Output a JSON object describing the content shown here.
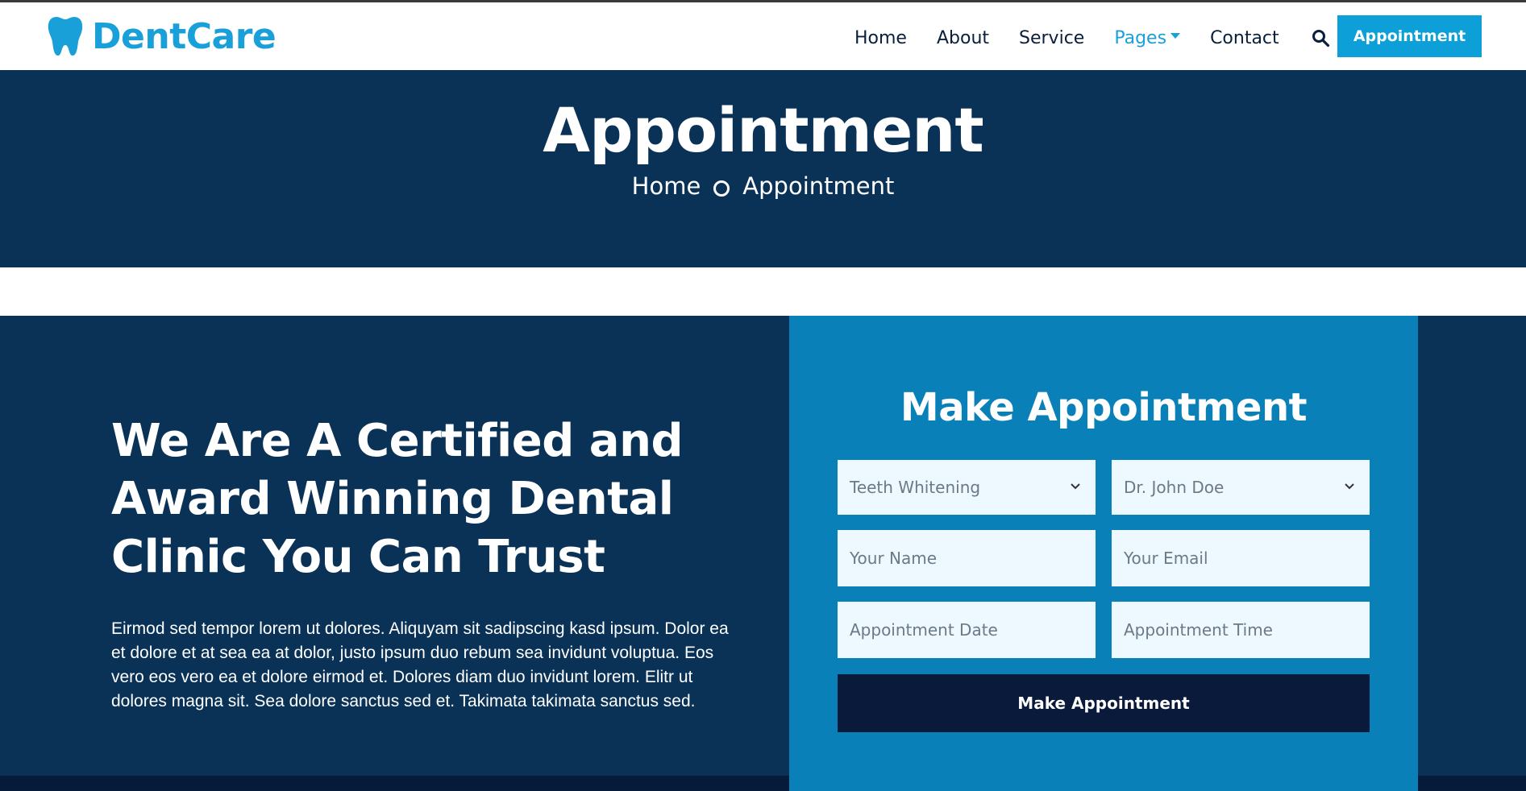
{
  "nav": {
    "brand": "DentCare",
    "links": [
      "Home",
      "About",
      "Service",
      "Pages",
      "Contact"
    ],
    "active_link": "Pages",
    "appointment_button": "Appointment"
  },
  "hero": {
    "title": "Appointment",
    "breadcrumb": [
      "Home",
      "Appointment"
    ]
  },
  "about": {
    "heading": "We Are A Certified and Award Winning Dental Clinic You Can Trust",
    "text": "Eirmod sed tempor lorem ut dolores. Aliquyam sit sadipscing kasd ipsum. Dolor ea et dolore et at sea ea at dolor, justo ipsum duo rebum sea invidunt voluptua. Eos vero eos vero ea et dolore eirmod et. Dolores diam duo invidunt lorem. Elitr ut dolores magna sit. Sea dolore sanctus sed et. Takimata takimata sanctus sed."
  },
  "form": {
    "title": "Make Appointment",
    "service_select": "Teeth Whitening",
    "doctor_select": "Dr. John Doe",
    "name_placeholder": "Your Name",
    "email_placeholder": "Your Email",
    "date_placeholder": "Appointment Date",
    "time_placeholder": "Appointment Time",
    "submit": "Make Appointment"
  },
  "colors": {
    "brand": "#1aa0d8",
    "dark_navy": "#0a3257",
    "form_blue": "#0a80b8",
    "button_dark": "#091a3a"
  }
}
